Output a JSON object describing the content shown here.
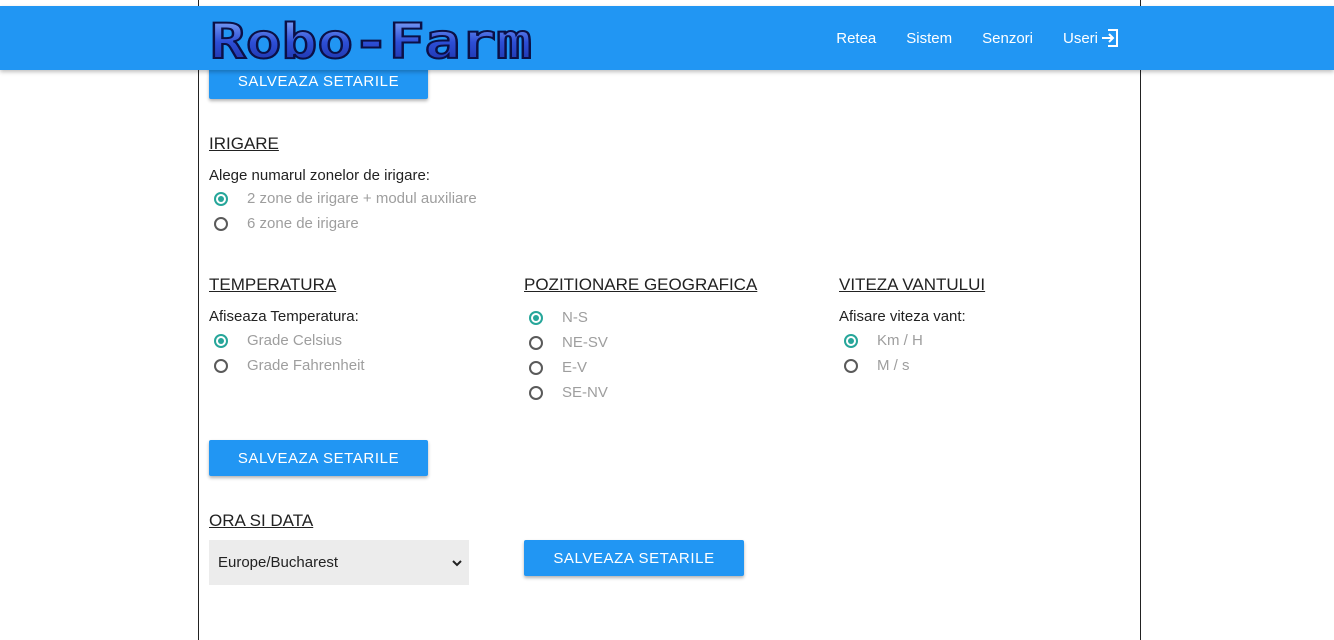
{
  "header": {
    "logo_text": "Robo-Farm",
    "nav": [
      "Retea",
      "Sistem",
      "Senzori",
      "Useri"
    ],
    "logout_icon": "logout-icon"
  },
  "buttons": {
    "save_top": "SALVEAZA SETARILE",
    "save_middle": "SALVEAZA SETARILE",
    "save_time": "SALVEAZA SETARILE"
  },
  "irigare": {
    "title": "IRIGARE",
    "label": "Alege numarul zonelor de irigare:",
    "options": [
      "2 zone de irigare + modul auxiliare",
      "6 zone de irigare"
    ],
    "selected": 0
  },
  "temperatura": {
    "title": "TEMPERATURA",
    "label": "Afiseaza Temperatura:",
    "options": [
      "Grade Celsius",
      "Grade Fahrenheit"
    ],
    "selected": 0
  },
  "pozitionare": {
    "title": "POZITIONARE GEOGRAFICA",
    "options": [
      "N-S",
      "NE-SV",
      "E-V",
      "SE-NV"
    ],
    "selected": 0
  },
  "vant": {
    "title": "VITEZA VANTULUI",
    "label": "Afisare viteza vant:",
    "options": [
      "Km / H",
      "M / s"
    ],
    "selected": 0
  },
  "ora": {
    "title": "ORA SI DATA",
    "timezone_value": "Europe/Bucharest"
  },
  "colors": {
    "primary": "#2196f3",
    "radio_checked": "#26a69a"
  }
}
